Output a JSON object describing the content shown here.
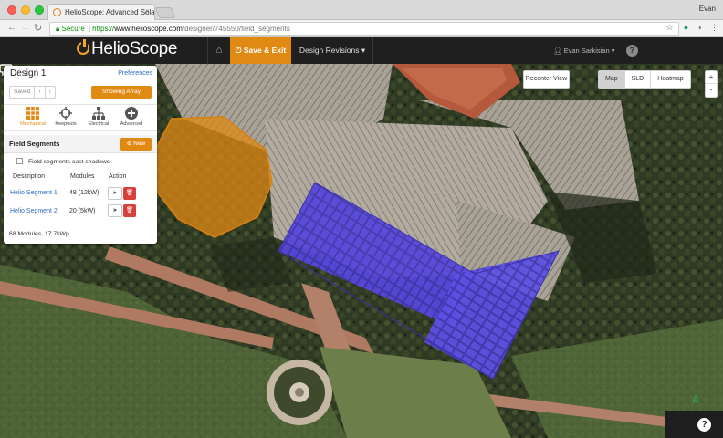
{
  "browser": {
    "tab_title": "HelioScope: Advanced Solar D",
    "tab_close": "×",
    "user_name": "Evan",
    "address": {
      "secure_label": "Secure",
      "scheme": "https://",
      "host": "www.helioscope.com",
      "path": "/designer/745550/field_segments"
    },
    "icons": [
      "back-icon",
      "forward-icon",
      "reload-icon",
      "star-icon",
      "extension-icon",
      "menu-icon"
    ]
  },
  "header": {
    "logo_text": "HelioScope",
    "home_icon": "home-icon",
    "save_exit_label": "Save & Exit",
    "revisions_label": "Design Revisions",
    "user_label": "Evan Sarkisian",
    "help_label": "?",
    "accent_color": "#e08a14"
  },
  "panel": {
    "design_title": "Design 1",
    "preferences_link": "Preferences",
    "saved_label": "Saved",
    "prev_label": "‹",
    "next_label": "›",
    "showing_array_label": "Showing Array",
    "tools": [
      {
        "label": "Mechanical",
        "icon": "grid-icon",
        "active": true
      },
      {
        "label": "Keepouts",
        "icon": "crosshair-icon",
        "active": false
      },
      {
        "label": "Electrical",
        "icon": "hierarchy-icon",
        "active": false
      },
      {
        "label": "Advanced",
        "icon": "plus-circle-icon",
        "active": false
      }
    ],
    "field_segments": {
      "title": "Field Segments",
      "new_label": "New",
      "cast_shadows_label": "Field segments cast shadows",
      "cast_shadows_checked": false,
      "columns": [
        "Description",
        "Modules",
        "Action"
      ],
      "rows": [
        {
          "description": "Helio Segment 1",
          "modules": "48 (12kW)"
        },
        {
          "description": "Helio Segment 2",
          "modules": "20 (5kW)"
        }
      ],
      "summary": "68 Modules, 17.7kWp"
    }
  },
  "map_controls": {
    "recenter_label": "Recenter View",
    "view_modes": [
      {
        "label": "Map",
        "active": true
      },
      {
        "label": "SLD",
        "active": false
      },
      {
        "label": "Heatmap",
        "active": false
      }
    ],
    "zoom_in": "+",
    "zoom_out": "-",
    "north_label": "N",
    "chat_icon": "chat-icon",
    "help_label": "?",
    "array_color": "#5a4ee0",
    "keepout_color": "#e08a14"
  }
}
